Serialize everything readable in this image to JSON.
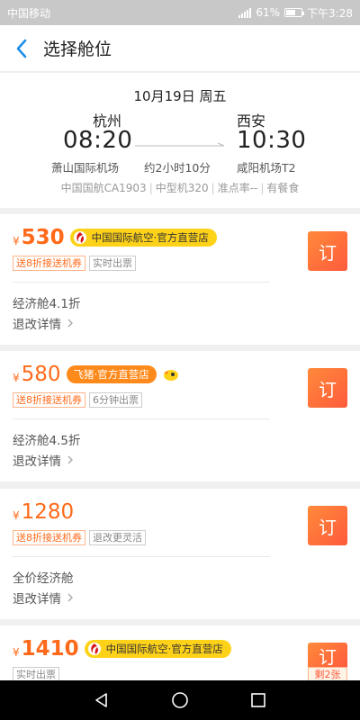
{
  "status_bar": {
    "carrier": "中国移动",
    "battery": "61%",
    "time": "下午3:28",
    "battery_level": 0.61
  },
  "header": {
    "title": "选择舱位"
  },
  "flight": {
    "date": "10月19日 周五",
    "dep_city": "杭州",
    "dep_time": "08:20",
    "dep_airport": "萧山国际机场",
    "duration": "约2小时10分",
    "arr_city": "西安",
    "arr_time": "10:30",
    "arr_airport": "咸阳机场T2",
    "airline_flight": "中国国航CA1903",
    "aircraft": "中型机320",
    "on_time": "准点率--",
    "meal": "有餐食"
  },
  "fares": [
    {
      "currency": "¥",
      "price": "530",
      "store": "中国国际航空·官方直营店",
      "tags": [
        "送8折接送机券",
        "实时出票"
      ],
      "cabin": "经济舱4.1折",
      "refund": "退改详情",
      "book": "订"
    },
    {
      "currency": "¥",
      "price": "580",
      "store": "飞猪·官方直营店",
      "tags": [
        "送8折接送机券",
        "6分钟出票"
      ],
      "cabin": "经济舱4.5折",
      "refund": "退改详情",
      "book": "订"
    },
    {
      "currency": "¥",
      "price": "1280",
      "tags": [
        "送8折接送机券",
        "退改更灵活"
      ],
      "cabin": "全价经济舱",
      "refund": "退改详情",
      "book": "订"
    },
    {
      "currency": "¥",
      "price": "1410",
      "store": "中国国际航空·官方直营店",
      "tags": [
        "实时出票"
      ],
      "book": "订",
      "remaining": "剩2张"
    }
  ],
  "icons": {
    "back": "back-arrow-icon",
    "chevron": "chevron-right-icon",
    "air_china": "air-china-logo-icon",
    "fliggy": "fliggy-logo-icon"
  },
  "colors": {
    "accent": "#ff6a1a",
    "badge_yellow": "#ffd21a",
    "book_btn": "#ff5a3c",
    "back": "#1b8fe6"
  }
}
